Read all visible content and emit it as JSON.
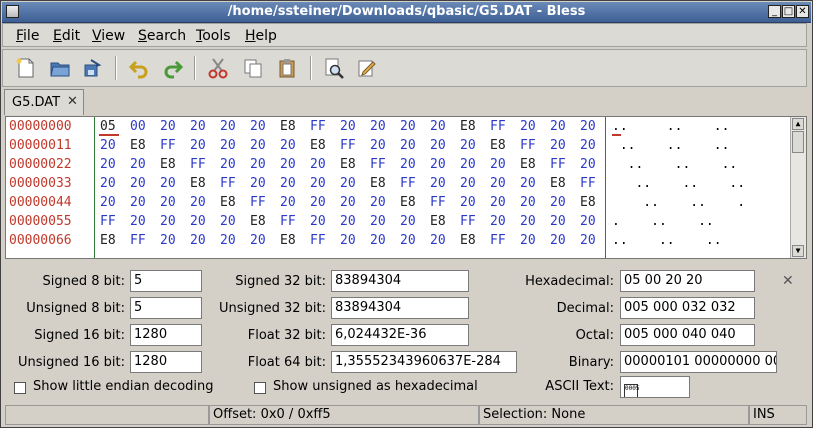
{
  "window": {
    "title": "/home/ssteiner/Downloads/qbasic/G5.DAT - Bless"
  },
  "menubar": [
    {
      "label": "File",
      "u": "F",
      "rest": "ile"
    },
    {
      "label": "Edit",
      "u": "E",
      "rest": "dit"
    },
    {
      "label": "View",
      "u": "V",
      "rest": "iew"
    },
    {
      "label": "Search",
      "u": "S",
      "rest": "earch"
    },
    {
      "label": "Tools",
      "u": "T",
      "rest": "ools"
    },
    {
      "label": "Help",
      "u": "H",
      "rest": "elp"
    }
  ],
  "toolbar": [
    "new-file-icon",
    "open-file-icon",
    "save-file-icon",
    "undo-icon",
    "redo-icon",
    "cut-icon",
    "copy-icon",
    "paste-icon",
    "find-icon",
    "preferences-icon"
  ],
  "tab": {
    "label": "G5.DAT",
    "close": "✕"
  },
  "hex": {
    "rows": [
      {
        "offset": "00000000",
        "bytes": [
          "05",
          "00",
          "20",
          "20",
          "20",
          "20",
          "E8",
          "FF",
          "20",
          "20",
          "20",
          "20",
          "E8",
          "FF",
          "20",
          "20",
          "20"
        ],
        "ascii": "..     ..    .."
      },
      {
        "offset": "00000011",
        "bytes": [
          "20",
          "E8",
          "FF",
          "20",
          "20",
          "20",
          "20",
          "E8",
          "FF",
          "20",
          "20",
          "20",
          "20",
          "E8",
          "FF",
          "20",
          "20"
        ],
        "ascii": " ..    ..    .."
      },
      {
        "offset": "00000022",
        "bytes": [
          "20",
          "20",
          "E8",
          "FF",
          "20",
          "20",
          "20",
          "20",
          "E8",
          "FF",
          "20",
          "20",
          "20",
          "20",
          "E8",
          "FF",
          "20"
        ],
        "ascii": "  ..    ..    .."
      },
      {
        "offset": "00000033",
        "bytes": [
          "20",
          "20",
          "20",
          "E8",
          "FF",
          "20",
          "20",
          "20",
          "20",
          "E8",
          "FF",
          "20",
          "20",
          "20",
          "20",
          "E8",
          "FF"
        ],
        "ascii": "   ..    ..    .."
      },
      {
        "offset": "00000044",
        "bytes": [
          "20",
          "20",
          "20",
          "20",
          "E8",
          "FF",
          "20",
          "20",
          "20",
          "20",
          "E8",
          "FF",
          "20",
          "20",
          "20",
          "20",
          "E8"
        ],
        "ascii": "    ..    ..    ."
      },
      {
        "offset": "00000055",
        "bytes": [
          "FF",
          "20",
          "20",
          "20",
          "20",
          "E8",
          "FF",
          "20",
          "20",
          "20",
          "20",
          "E8",
          "FF",
          "20",
          "20",
          "20",
          "20"
        ],
        "ascii": ".    ..    ..    "
      },
      {
        "offset": "00000066",
        "bytes": [
          "E8",
          "FF",
          "20",
          "20",
          "20",
          "20",
          "E8",
          "FF",
          "20",
          "20",
          "20",
          "20",
          "E8",
          "FF",
          "20",
          "20",
          "20"
        ],
        "ascii": "..    ..    ..   "
      }
    ]
  },
  "panel": {
    "signed8_label": "Signed 8 bit:",
    "signed8": "5",
    "unsigned8_label": "Unsigned 8 bit:",
    "unsigned8": "5",
    "signed16_label": "Signed 16 bit:",
    "signed16": "1280",
    "unsigned16_label": "Unsigned 16 bit:",
    "unsigned16": "1280",
    "signed32_label": "Signed 32 bit:",
    "signed32": "83894304",
    "unsigned32_label": "Unsigned 32 bit:",
    "unsigned32": "83894304",
    "float32_label": "Float 32 bit:",
    "float32": "6,024432E-36",
    "float64_label": "Float 64 bit:",
    "float64": "1,35552343960637E-284",
    "hex_label": "Hexadecimal:",
    "hex": "05 00 20 20",
    "dec_label": "Decimal:",
    "dec": "005 000 032 032",
    "oct_label": "Octal:",
    "oct": "005 000 040 040",
    "bin_label": "Binary:",
    "bin": "00000101 00000000 00",
    "little_endian_label": "Show little endian decoding",
    "unsigned_hex_label": "Show unsigned as hexadecimal",
    "ascii_label": "ASCII Text:",
    "ascii_glyph": "0005"
  },
  "statusbar": {
    "offset": "Offset: 0x0 / 0xff5",
    "selection": "Selection: None",
    "mode": "INS"
  }
}
